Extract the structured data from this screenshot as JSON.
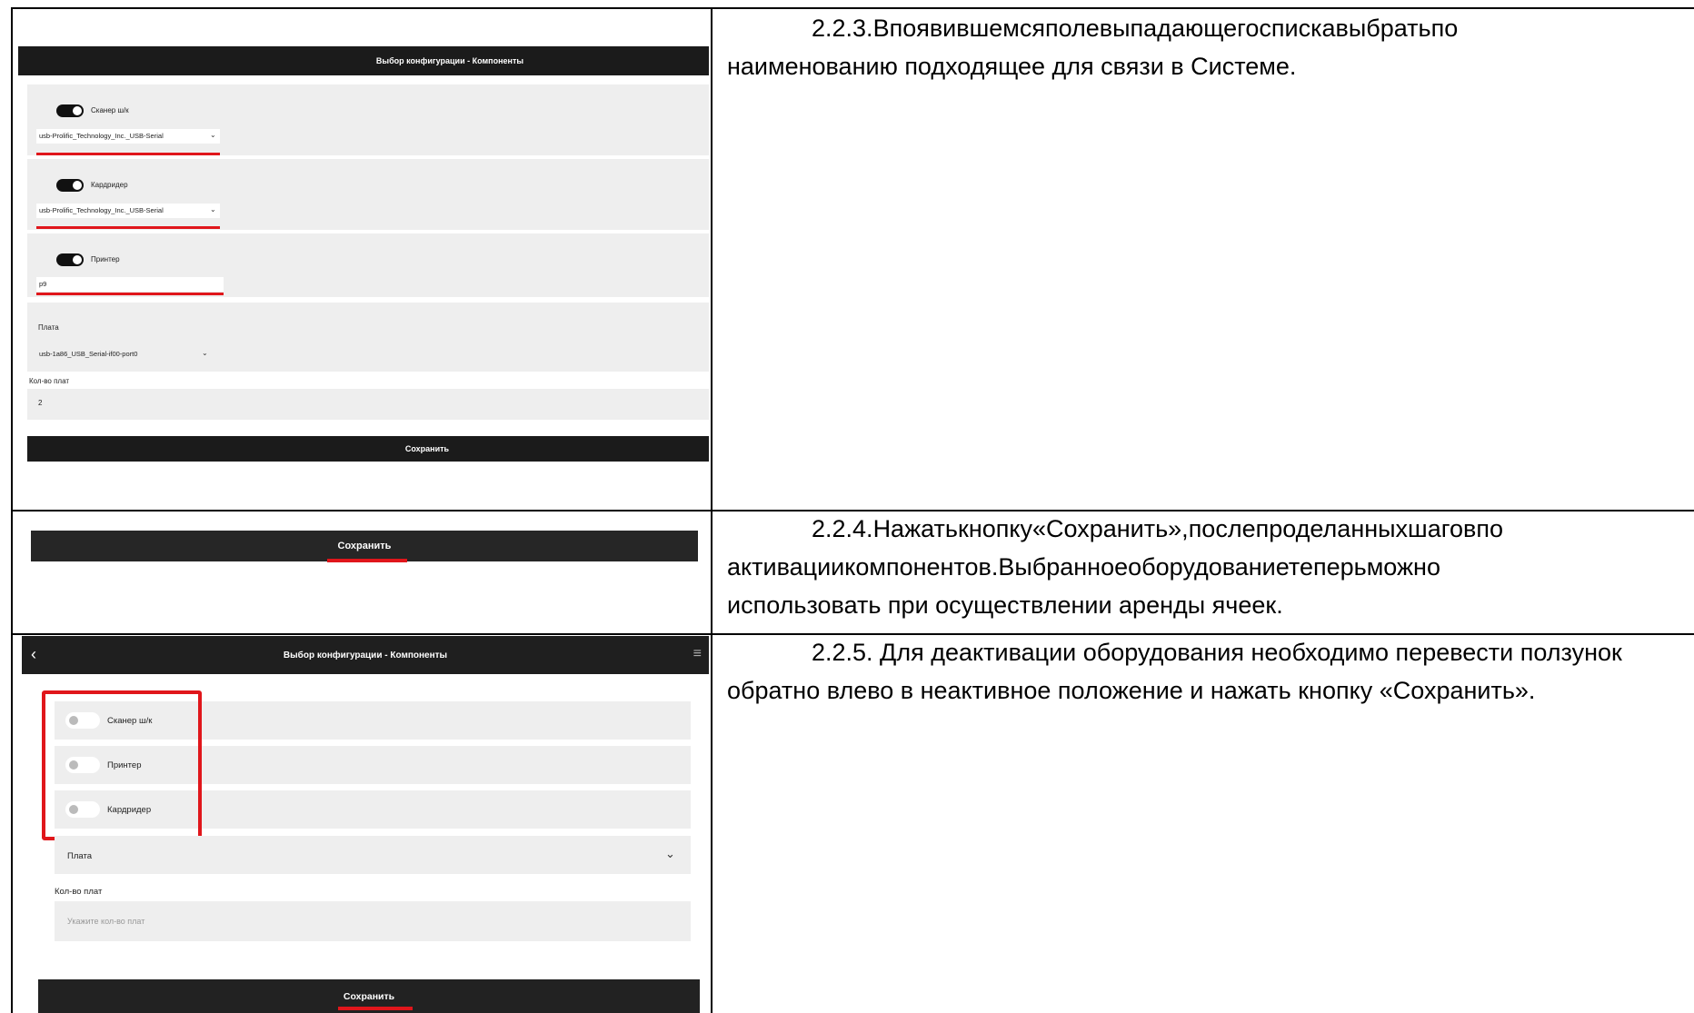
{
  "step_223": {
    "line1_words": [
      "2.2.3.",
      "В",
      "появившемся",
      "поле",
      "выпадающего",
      "списка",
      "выбрать",
      "по"
    ],
    "line2": "наименованию подходящее для связи в Системе."
  },
  "step_224": {
    "line1_words": [
      "2.2.4.",
      "Нажать",
      "кнопку",
      "«Сохранить»,",
      "после",
      "проделанных",
      "шагов",
      "по"
    ],
    "line2_words": [
      "активации",
      "компонентов.",
      "Выбранное",
      "оборудование",
      "теперь",
      "можно"
    ],
    "line3": "использовать при осуществлении аренды ячеек."
  },
  "step_225": {
    "line1": "2.2.5. Для деактивации оборудования необходимо перевести ползунок",
    "line2": "обратно влево в неактивное положение и нажать кнопку «Сохранить»."
  },
  "shot1": {
    "title": "Выбор конфигурации - Компоненты",
    "scanner_label": "Сканер ш/к",
    "scanner_value": "usb-Prolific_Technology_Inc._USB-Serial",
    "cardreader_label": "Кардридер",
    "cardreader_value": "usb-Prolific_Technology_Inc._USB-Serial",
    "printer_label": "Принтер",
    "printer_value": "p9",
    "board_label": "Плата",
    "board_value": "usb-1a86_USB_Serial-if00-port0",
    "board_count_label": "Кол-во плат",
    "board_count_value": "2",
    "save_label": "Сохранить"
  },
  "shot2": {
    "save_label": "Сохранить"
  },
  "shot3": {
    "title": "Выбор конфигурации - Компоненты",
    "scanner_label": "Сканер ш/к",
    "printer_label": "Принтер",
    "cardreader_label": "Кардридер",
    "board_label": "Плата",
    "board_count_label": "Кол-во плат",
    "board_count_placeholder": "Укажите кол-во плат",
    "save_label": "Сохранить"
  },
  "colors": {
    "highlight": "#e0161b",
    "bar": "#1b1b1b",
    "card": "#eeeeee"
  }
}
